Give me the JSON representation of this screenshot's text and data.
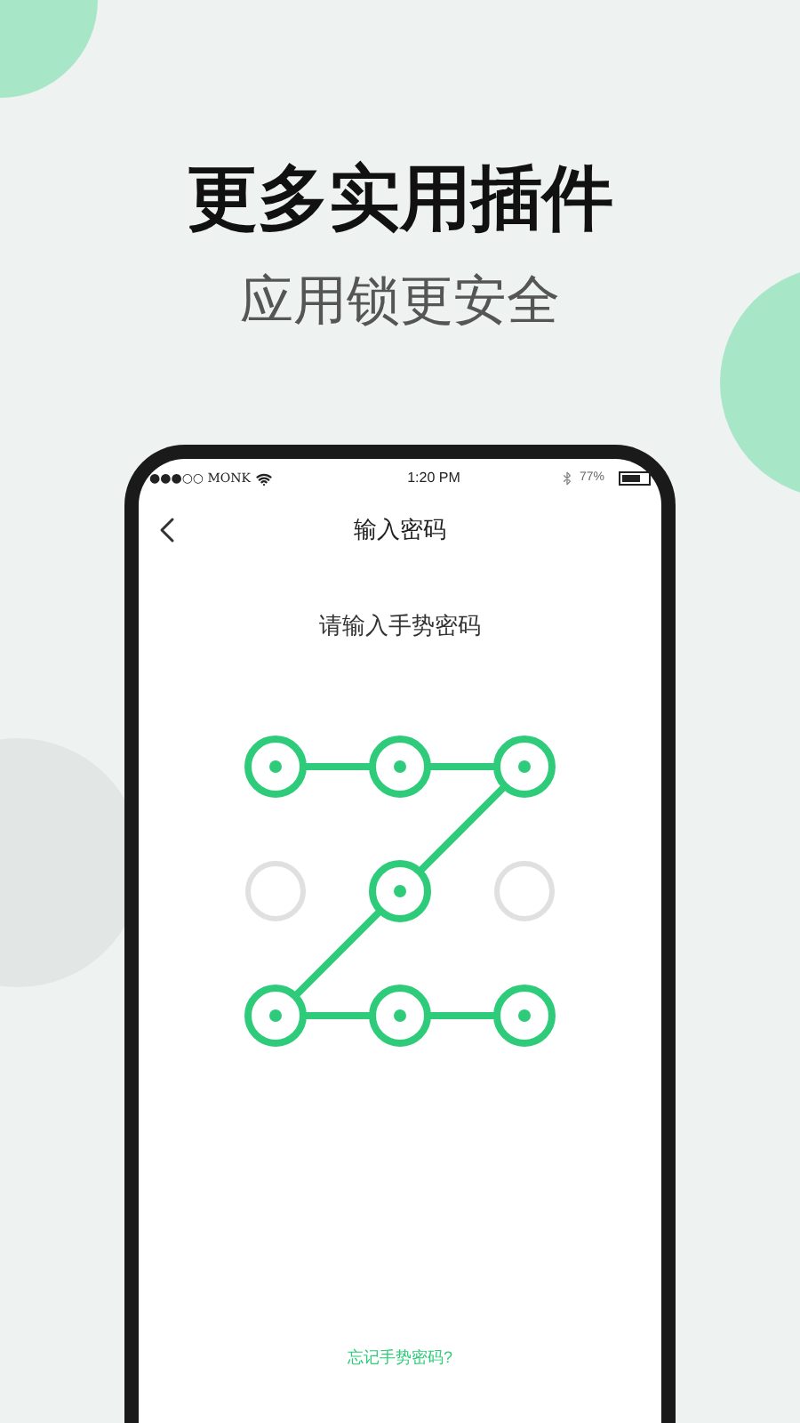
{
  "headline": "更多实用插件",
  "subheadline": "应用锁更安全",
  "status_bar": {
    "carrier": "●●●○○ MONK",
    "time": "1:20 PM",
    "battery": "77%"
  },
  "nav": {
    "title": "输入密码"
  },
  "prompt": "请输入手势密码",
  "dots": [
    {
      "selected": true
    },
    {
      "selected": true
    },
    {
      "selected": true
    },
    {
      "selected": false
    },
    {
      "selected": true
    },
    {
      "selected": false
    },
    {
      "selected": true
    },
    {
      "selected": true
    },
    {
      "selected": true
    }
  ],
  "forgot_link": "忘记手势密码?"
}
